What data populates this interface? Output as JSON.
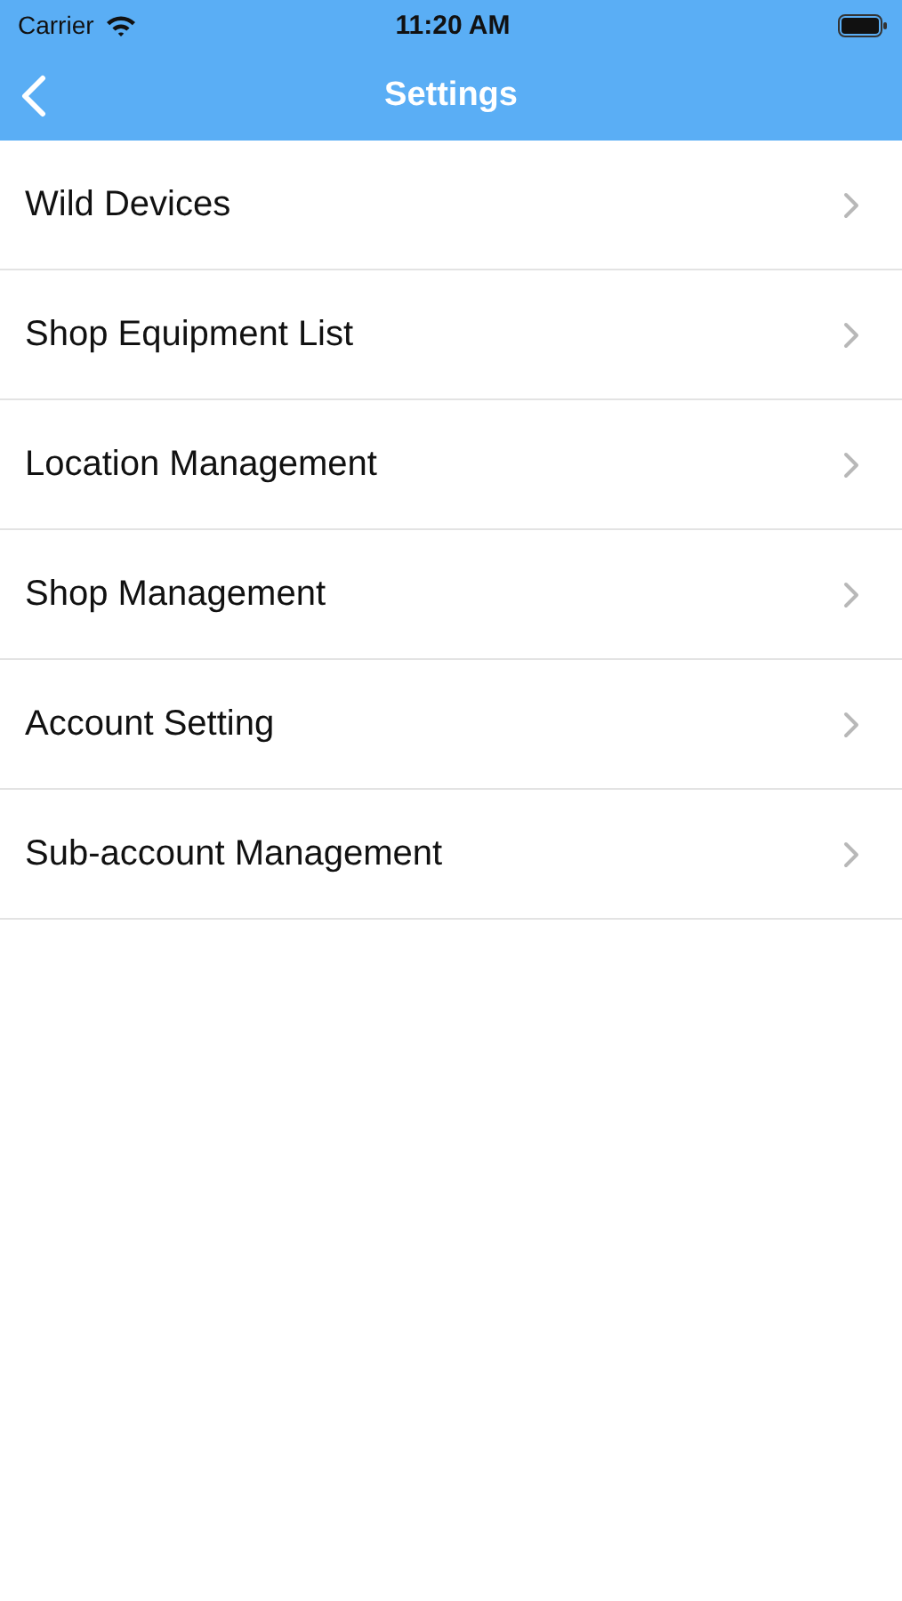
{
  "status_bar": {
    "carrier": "Carrier",
    "time": "11:20 AM"
  },
  "nav_bar": {
    "title": "Settings"
  },
  "menu_items": [
    {
      "label": "Wild Devices"
    },
    {
      "label": "Shop Equipment List"
    },
    {
      "label": "Location Management"
    },
    {
      "label": "Shop Management"
    },
    {
      "label": "Account Setting"
    },
    {
      "label": "Sub-account Management"
    }
  ]
}
